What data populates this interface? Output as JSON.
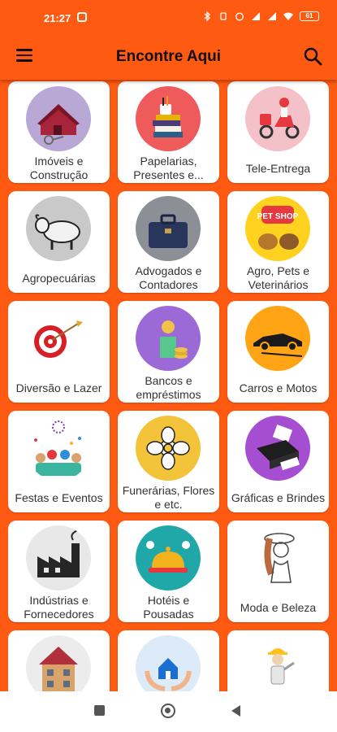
{
  "status_bar": {
    "time": "21:27",
    "battery": "61"
  },
  "app_bar": {
    "title": "Encontre Aqui"
  },
  "categories": [
    {
      "label": "Imóveis e Construção",
      "icon": "house-keys-icon"
    },
    {
      "label": "Papelarias, Presentes e...",
      "icon": "books-stack-icon"
    },
    {
      "label": "Tele-Entrega",
      "icon": "delivery-scooter-icon"
    },
    {
      "label": "Agropecuárias",
      "icon": "ox-icon"
    },
    {
      "label": "Advogados e Contadores",
      "icon": "briefcase-icon"
    },
    {
      "label": "Agro, Pets e Veterinários",
      "icon": "pet-shop-icon",
      "badge_text": "PET SHOP"
    },
    {
      "label": "Diversão e Lazer",
      "icon": "dartboard-icon"
    },
    {
      "label": "Bancos e empréstimos",
      "icon": "coins-money-icon"
    },
    {
      "label": "Carros e Motos",
      "icon": "sports-car-icon"
    },
    {
      "label": "Festas e Eventos",
      "icon": "party-crowd-icon"
    },
    {
      "label": "Funerárias, Flores e etc.",
      "icon": "flower-icon"
    },
    {
      "label": "Gráficas e Brindes",
      "icon": "printer-icon"
    },
    {
      "label": "Indústrias e Fornecedores",
      "icon": "factory-icon"
    },
    {
      "label": "Hotéis e Pousadas",
      "icon": "hotel-bell-icon"
    },
    {
      "label": "Moda e Beleza",
      "icon": "fashion-woman-icon"
    },
    {
      "label": "",
      "icon": "building-icon"
    },
    {
      "label": "",
      "icon": "protected-home-icon"
    },
    {
      "label": "",
      "icon": "worker-icon"
    }
  ],
  "colors": {
    "brand": "#ff5a12",
    "card": "#ffffff",
    "text": "#333333"
  }
}
